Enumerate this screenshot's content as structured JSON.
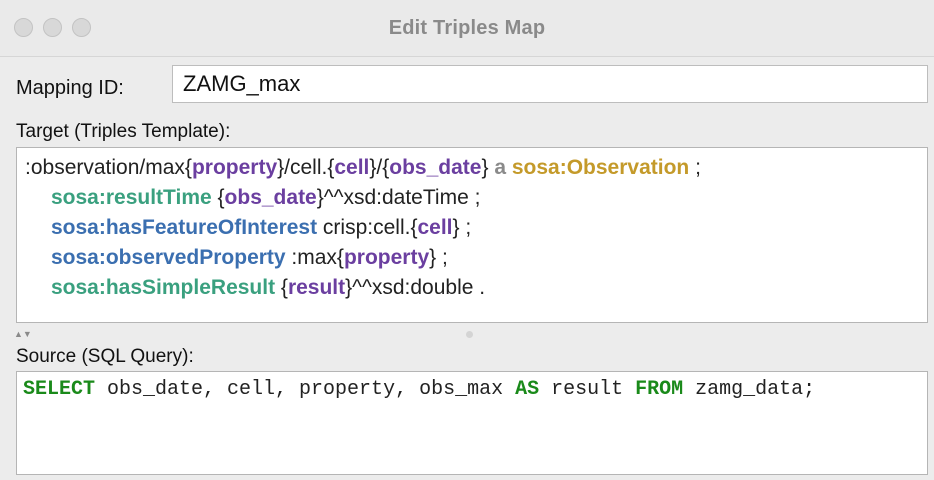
{
  "window": {
    "title": "Edit Triples Map",
    "colors": {
      "background": "#ececec",
      "titlebar": "#eaeaea",
      "traffic_light": "#d8d8d8"
    }
  },
  "mapping": {
    "label": "Mapping ID:",
    "value": "ZAMG_max"
  },
  "target": {
    "label": "Target (Triples Template):",
    "colors": {
      "predicate": "#3aa07f",
      "variable": "#6b3fa0",
      "class": "#c49a2a",
      "namespace": "#3b6fb0",
      "keyword": "#8a8a8a"
    },
    "lines": [
      [
        {
          "t": ":observation/max{",
          "c": ""
        },
        {
          "t": "property",
          "c": "var"
        },
        {
          "t": "}/cell.{",
          "c": ""
        },
        {
          "t": "cell",
          "c": "var"
        },
        {
          "t": "}/{",
          "c": ""
        },
        {
          "t": "obs_date",
          "c": "var"
        },
        {
          "t": "} ",
          "c": ""
        },
        {
          "t": "a",
          "c": "a"
        },
        {
          "t": " ",
          "c": ""
        },
        {
          "t": "sosa:Observation",
          "c": "class"
        },
        {
          "t": " ;",
          "c": ""
        }
      ],
      [
        {
          "t": "sosa:resultTime",
          "c": "pred"
        },
        {
          "t": " {",
          "c": ""
        },
        {
          "t": "obs_date",
          "c": "var"
        },
        {
          "t": "}^^xsd:dateTime ;",
          "c": ""
        }
      ],
      [
        {
          "t": "sosa:hasFeatureOfInterest",
          "c": "ns"
        },
        {
          "t": " crisp:cell.{",
          "c": ""
        },
        {
          "t": "cell",
          "c": "var"
        },
        {
          "t": "} ;",
          "c": ""
        }
      ],
      [
        {
          "t": "sosa:observedProperty",
          "c": "ns"
        },
        {
          "t": " :max{",
          "c": ""
        },
        {
          "t": "property",
          "c": "var"
        },
        {
          "t": "} ;",
          "c": ""
        }
      ],
      [
        {
          "t": "sosa:hasSimpleResult",
          "c": "pred"
        },
        {
          "t": " {",
          "c": ""
        },
        {
          "t": "result",
          "c": "var"
        },
        {
          "t": "}^^xsd:double .",
          "c": ""
        }
      ]
    ]
  },
  "source": {
    "label": "Source (SQL Query):",
    "keyword_color": "#1a8a1a",
    "tokens": [
      {
        "t": "SELECT",
        "kw": true
      },
      {
        "t": " obs_date, cell, property, obs_max ",
        "kw": false
      },
      {
        "t": "AS",
        "kw": true
      },
      {
        "t": " result ",
        "kw": false
      },
      {
        "t": "FROM",
        "kw": true
      },
      {
        "t": " zamg_data;",
        "kw": false
      }
    ]
  },
  "icons": {
    "traffic_lights": [
      "close-icon",
      "minimize-icon",
      "zoom-icon"
    ],
    "splitter": "split-arrows-icon"
  }
}
